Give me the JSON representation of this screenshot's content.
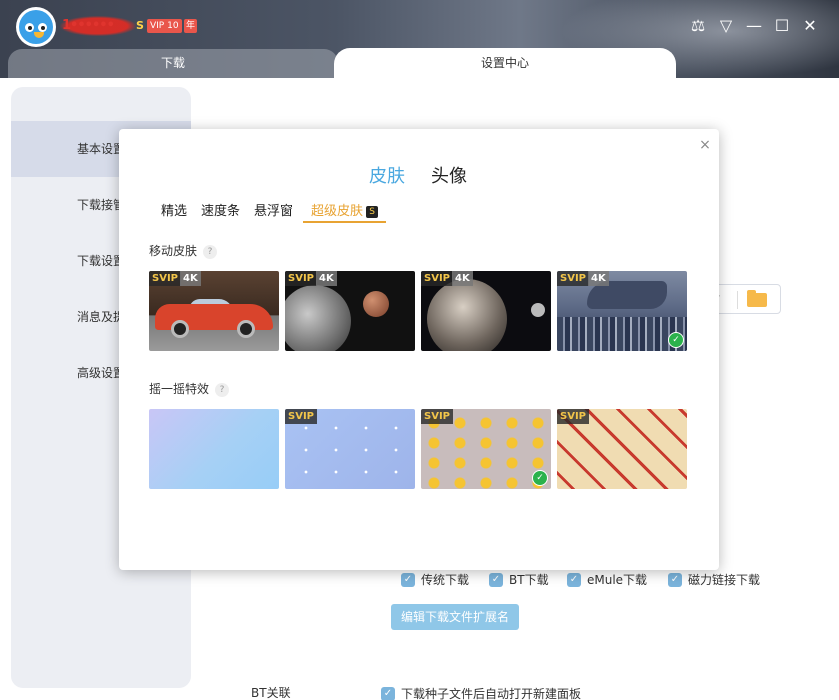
{
  "titlebar": {
    "username_masked": "1••••••",
    "svip_symbol": "S",
    "vip_badge": "VIP 10",
    "year_badge": "年",
    "icons": [
      "tshirt-icon",
      "dropdown-icon",
      "minimize-icon",
      "maximize-icon",
      "close-icon"
    ],
    "icon_glyphs": {
      "skin": "⚖",
      "menu": "▽",
      "minimize": "—",
      "maximize": "☐",
      "close": "✕"
    }
  },
  "tabs": {
    "download": "下载",
    "settings": "设置中心"
  },
  "sidebar": {
    "items": [
      {
        "label": "基本设置",
        "active": true
      },
      {
        "label": "下载接管设置",
        "active": false
      },
      {
        "label": "下载设置",
        "active": false
      },
      {
        "label": "消息及提醒",
        "active": false
      },
      {
        "label": "高级设置",
        "active": false
      }
    ]
  },
  "background": {
    "checkboxes": [
      {
        "label": "传统下载",
        "checked": true
      },
      {
        "label": "BT下载",
        "checked": true
      },
      {
        "label": "eMule下载",
        "checked": true
      },
      {
        "label": "磁力链接下载",
        "checked": true
      }
    ],
    "edit_ext_button": "编辑下载文件扩展名",
    "bt_label": "BT关联",
    "bt_checkbox": "下载种子文件后自动打开新建面板",
    "check_glyph": "✓"
  },
  "dialog": {
    "close_glyph": "×",
    "top_tabs": {
      "skin": "皮肤",
      "avatar": "头像"
    },
    "sub_tabs": [
      {
        "label": "精选",
        "active": false
      },
      {
        "label": "速度条",
        "active": false
      },
      {
        "label": "悬浮窗",
        "active": false
      },
      {
        "label": "超级皮肤",
        "active": true
      }
    ],
    "super_skin_icon": "S",
    "section_dynamic": "移动皮肤",
    "section_shake": "摇一摇特效",
    "help_glyph": "?",
    "dynamic_skins": [
      {
        "svip": "SVIP",
        "res": "4K",
        "theme": "car",
        "selected": false
      },
      {
        "svip": "SVIP",
        "res": "4K",
        "theme": "moon",
        "selected": false
      },
      {
        "svip": "SVIP",
        "res": "4K",
        "theme": "planet",
        "selected": false
      },
      {
        "svip": "SVIP",
        "res": "4K",
        "theme": "whale",
        "selected": true
      }
    ],
    "shake_effects": [
      {
        "svip": "",
        "theme": "gradient",
        "selected": false
      },
      {
        "svip": "SVIP",
        "theme": "dots",
        "selected": false
      },
      {
        "svip": "SVIP",
        "theme": "gems",
        "selected": true
      },
      {
        "svip": "SVIP",
        "theme": "firecracker",
        "selected": false
      }
    ],
    "selected_glyph": "✓"
  }
}
